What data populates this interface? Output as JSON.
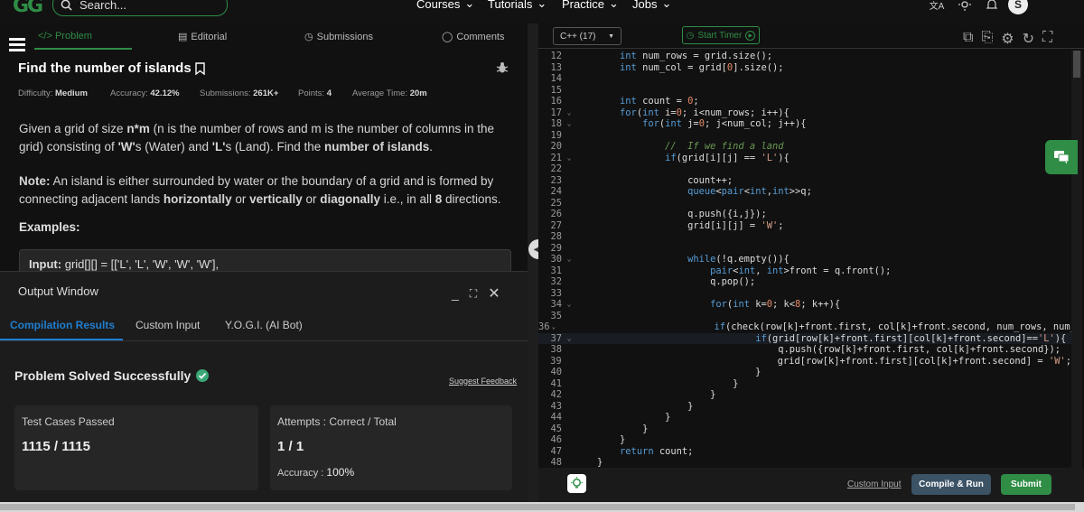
{
  "topnav": {
    "logo": "GG",
    "search_placeholder": "Search...",
    "links": [
      "Courses",
      "Tutorials",
      "Practice",
      "Jobs"
    ],
    "user_initial": "S"
  },
  "problem": {
    "tabs": [
      "</> Problem",
      "Editorial",
      "Submissions",
      "Comments"
    ],
    "title": "Find the number of islands",
    "meta": [
      {
        "label": "Difficulty:",
        "value": "Medium"
      },
      {
        "label": "Accuracy:",
        "value": "42.12%"
      },
      {
        "label": "Submissions:",
        "value": "261K+"
      },
      {
        "label": "Points:",
        "value": "4"
      },
      {
        "label": "Average Time:",
        "value": "20m"
      }
    ],
    "examples_label": "Examples:",
    "input_label": "Input:",
    "input_value": "grid[][] = [['L', 'L', 'W', 'W', 'W'],"
  },
  "output": {
    "title": "Output Window",
    "tabs": [
      "Compilation Results",
      "Custom Input",
      "Y.O.G.I. (AI Bot)"
    ],
    "status": "Problem Solved Successfully",
    "feedback": "Suggest Feedback",
    "cards": [
      {
        "label": "Test Cases Passed",
        "value": "1115 / 1115"
      },
      {
        "label": "Attempts : Correct / Total",
        "value": "1 / 1"
      }
    ],
    "accuracy_label": "Accuracy :",
    "accuracy_value": "100%"
  },
  "editor": {
    "language": "C++ (17)",
    "timer_label": "Start Timer",
    "custom_input": "Custom Input",
    "compile_label": "Compile & Run",
    "submit_label": "Submit",
    "highlight_line": 37,
    "lines": [
      {
        "n": 12,
        "f": false,
        "c": "        int num_rows = grid.size();"
      },
      {
        "n": 13,
        "f": false,
        "c": "        int num_col = grid[0].size();"
      },
      {
        "n": 14,
        "f": false,
        "c": ""
      },
      {
        "n": 15,
        "f": false,
        "c": ""
      },
      {
        "n": 16,
        "f": false,
        "c": "        int count = 0;"
      },
      {
        "n": 17,
        "f": true,
        "c": "        for(int i=0; i<num_rows; i++){"
      },
      {
        "n": 18,
        "f": true,
        "c": "            for(int j=0; j<num_col; j++){"
      },
      {
        "n": 19,
        "f": false,
        "c": ""
      },
      {
        "n": 20,
        "f": false,
        "c": "                //  If we find a land"
      },
      {
        "n": 21,
        "f": true,
        "c": "                if(grid[i][j] == 'L'){"
      },
      {
        "n": 22,
        "f": false,
        "c": ""
      },
      {
        "n": 23,
        "f": false,
        "c": "                    count++;"
      },
      {
        "n": 24,
        "f": false,
        "c": "                    queue<pair<int,int>>q;"
      },
      {
        "n": 25,
        "f": false,
        "c": ""
      },
      {
        "n": 26,
        "f": false,
        "c": "                    q.push({i,j});"
      },
      {
        "n": 27,
        "f": false,
        "c": "                    grid[i][j] = 'W';"
      },
      {
        "n": 28,
        "f": false,
        "c": ""
      },
      {
        "n": 29,
        "f": false,
        "c": ""
      },
      {
        "n": 30,
        "f": true,
        "c": "                    while(!q.empty()){"
      },
      {
        "n": 31,
        "f": false,
        "c": "                        pair<int, int>front = q.front();"
      },
      {
        "n": 32,
        "f": false,
        "c": "                        q.pop();"
      },
      {
        "n": 33,
        "f": false,
        "c": ""
      },
      {
        "n": 34,
        "f": true,
        "c": "                        for(int k=0; k<8; k++){"
      },
      {
        "n": 35,
        "f": false,
        "c": ""
      },
      {
        "n": 36,
        "f": true,
        "c": "                            if(check(row[k]+front.first, col[k]+front.second, num_rows, num_"
      },
      {
        "n": 37,
        "f": true,
        "c": "                                if(grid[row[k]+front.first][col[k]+front.second]=='L'){"
      },
      {
        "n": 38,
        "f": false,
        "c": "                                    q.push({row[k]+front.first, col[k]+front.second});"
      },
      {
        "n": 39,
        "f": false,
        "c": "                                    grid[row[k]+front.first][col[k]+front.second] = 'W';"
      },
      {
        "n": 40,
        "f": false,
        "c": "                                }"
      },
      {
        "n": 41,
        "f": false,
        "c": "                            }"
      },
      {
        "n": 42,
        "f": false,
        "c": "                        }"
      },
      {
        "n": 43,
        "f": false,
        "c": "                    }"
      },
      {
        "n": 44,
        "f": false,
        "c": "                }"
      },
      {
        "n": 45,
        "f": false,
        "c": "            }"
      },
      {
        "n": 46,
        "f": false,
        "c": "        }"
      },
      {
        "n": 47,
        "f": false,
        "c": "        return count;"
      },
      {
        "n": 48,
        "f": false,
        "c": "    }"
      }
    ]
  },
  "colors": {
    "accent": "#2f8d46",
    "link_blue": "#1f7ed0",
    "background": "#111111"
  }
}
